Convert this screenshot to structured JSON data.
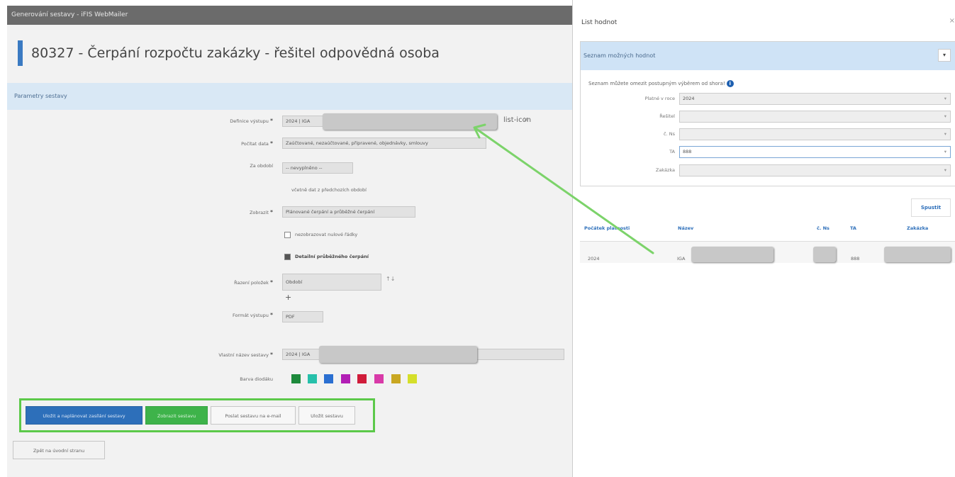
{
  "window": {
    "title": "Generování sestavy - iFIS WebMailer",
    "heading": "80327 - Čerpání rozpočtu zakázky - řešitel odpovědná osoba",
    "params_header": "Parametry sestavy"
  },
  "form": {
    "definice_label": "Definice výstupu",
    "definice_value": "2024 | IGA",
    "definice_list_icon": "list-icon",
    "definice_clear": "×",
    "druh_label": "Počítat data",
    "druh_value": "Zaúčtované, nezaúčtované, připravené, objednávky, smlouvy",
    "za_obdobi_label": "Za období",
    "za_obdobi_value": "-- nevyplněno --",
    "vcetne_text": "včetně dat z předchozích období",
    "zobrazit_label": "Zobrazit",
    "zobrazit_value": "Plánované čerpání a průběžné čerpání",
    "nezobrazovat_text": "nezobrazovat nulové řádky",
    "detail_text": "Detailní průběžného čerpání",
    "razeni_label": "Řazení položek",
    "razeni_value": "Období",
    "razeni_sort_icon": "↑↓",
    "razeni_add": "+",
    "format_label": "Formát výstupu",
    "format_value": "PDF",
    "nazev_label": "Vlastní název sestavy",
    "nazev_value": "2024 | IGA",
    "barva_label": "Barva diodáku",
    "required_mark": "*",
    "swatches": [
      "#1e8a3c",
      "#26c0aa",
      "#2a6fd1",
      "#b21fb5",
      "#d01c3a",
      "#d83aa8",
      "#c9a722",
      "#d5df2a"
    ]
  },
  "buttons": {
    "save_and_schedule": "Uložit a naplánovat zasílání sestavy",
    "show_report": "Zobrazit sestavu",
    "send_report": "Poslat sestavu na e-mail",
    "save_report": "Uložit sestavu",
    "back": "Zpět na úvodní stranu"
  },
  "panel": {
    "title": "List hodnot",
    "close": "×",
    "section_title": "Seznam možných hodnot",
    "section_toggle": "▾",
    "note": "Seznam můžete omezit postupným výběrem od shora!",
    "info_icon": "i",
    "fields": [
      {
        "label": "Platné v roce",
        "value": "2024"
      },
      {
        "label": "Řešitel",
        "value": ""
      },
      {
        "label": "č. Ns",
        "value": ""
      },
      {
        "label": "TA",
        "value": "888"
      },
      {
        "label": "Zakázka",
        "value": ""
      }
    ],
    "run_button": "Spustit",
    "table": {
      "headers": [
        "Počátek platnosti",
        "Název",
        "č. Ns",
        "TA",
        "Zakázka"
      ],
      "rows": [
        [
          "2024",
          "IGA",
          "",
          "888",
          ""
        ]
      ]
    }
  }
}
